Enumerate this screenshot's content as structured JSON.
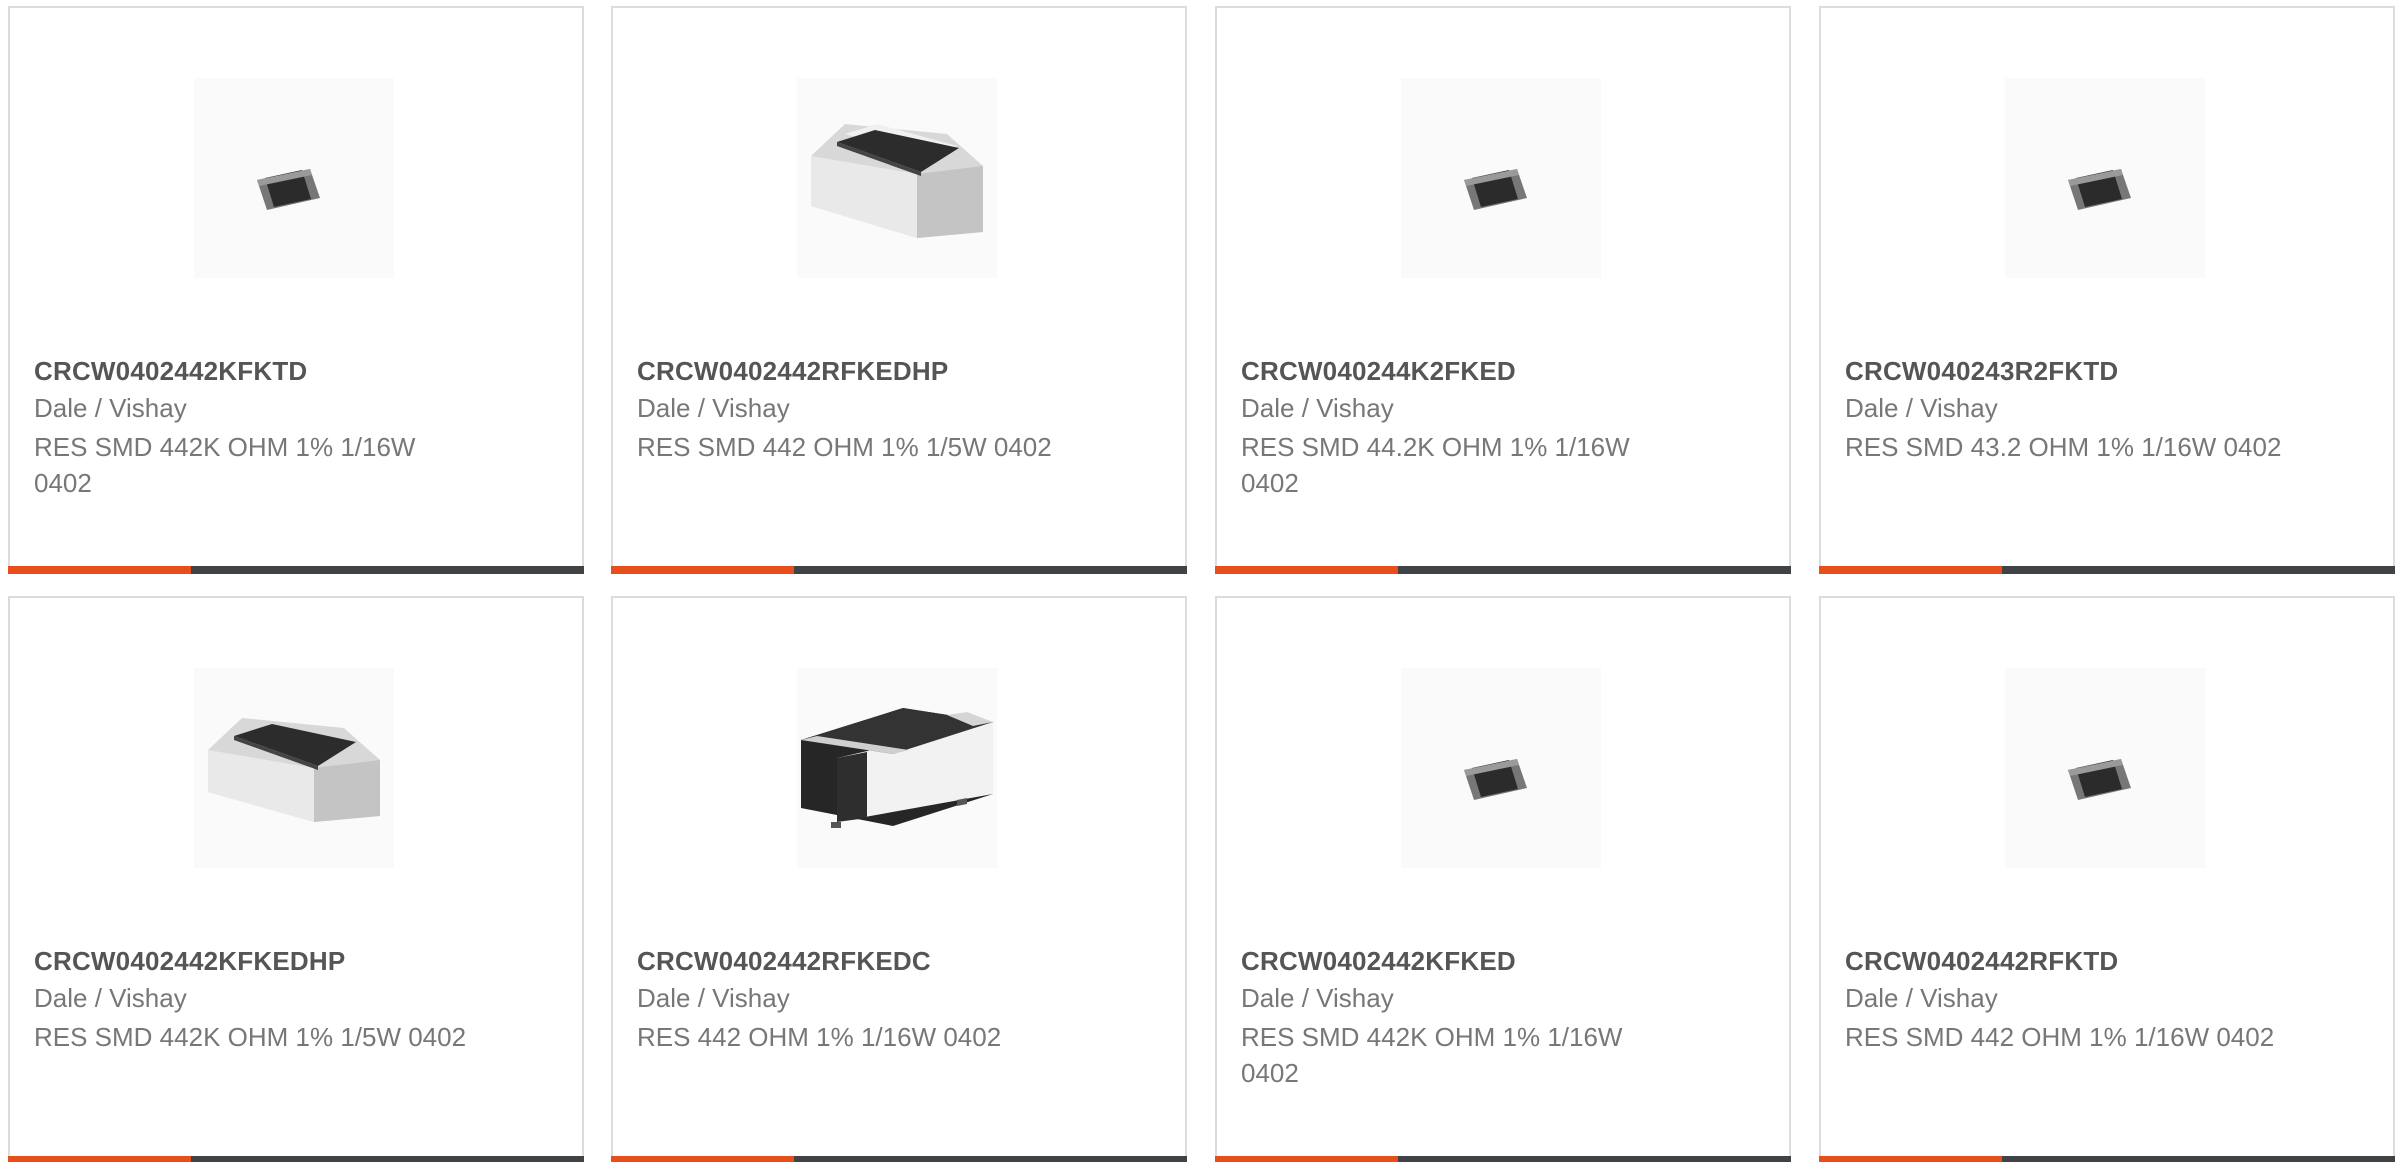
{
  "products": [
    {
      "part_number": "CRCW0402442KFKTD",
      "manufacturer": "Dale / Vishay",
      "description": "RES SMD 442K OHM 1% 1/16W 0402",
      "image_icon": "resistor-small-icon"
    },
    {
      "part_number": "CRCW0402442RFKEDHP",
      "manufacturer": "Dale / Vishay",
      "description": "RES SMD 442 OHM 1% 1/5W 0402",
      "image_icon": "resistor-large-icon"
    },
    {
      "part_number": "CRCW040244K2FKED",
      "manufacturer": "Dale / Vishay",
      "description": "RES SMD 44.2K OHM 1% 1/16W 0402",
      "image_icon": "resistor-small-icon"
    },
    {
      "part_number": "CRCW040243R2FKTD",
      "manufacturer": "Dale / Vishay",
      "description": "RES SMD 43.2 OHM 1% 1/16W 0402",
      "image_icon": "resistor-small-icon"
    },
    {
      "part_number": "CRCW0402442KFKEDHP",
      "manufacturer": "Dale / Vishay",
      "description": "RES SMD 442K OHM 1% 1/5W 0402",
      "image_icon": "resistor-large-icon"
    },
    {
      "part_number": "CRCW0402442RFKEDC",
      "manufacturer": "Dale / Vishay",
      "description": "RES 442 OHM 1% 1/16W 0402",
      "image_icon": "resistor-chip-side-icon"
    },
    {
      "part_number": "CRCW0402442KFKED",
      "manufacturer": "Dale / Vishay",
      "description": "RES SMD 442K OHM 1% 1/16W 0402",
      "image_icon": "resistor-small-icon"
    },
    {
      "part_number": "CRCW0402442RFKTD",
      "manufacturer": "Dale / Vishay",
      "description": "RES SMD 442 OHM 1% 1/16W 0402",
      "image_icon": "resistor-small-icon"
    }
  ],
  "colors": {
    "accent": "#e84e1b",
    "bar": "#3f4346",
    "border": "#dcdcdc",
    "part_text": "#555555",
    "body_text": "#777777"
  }
}
